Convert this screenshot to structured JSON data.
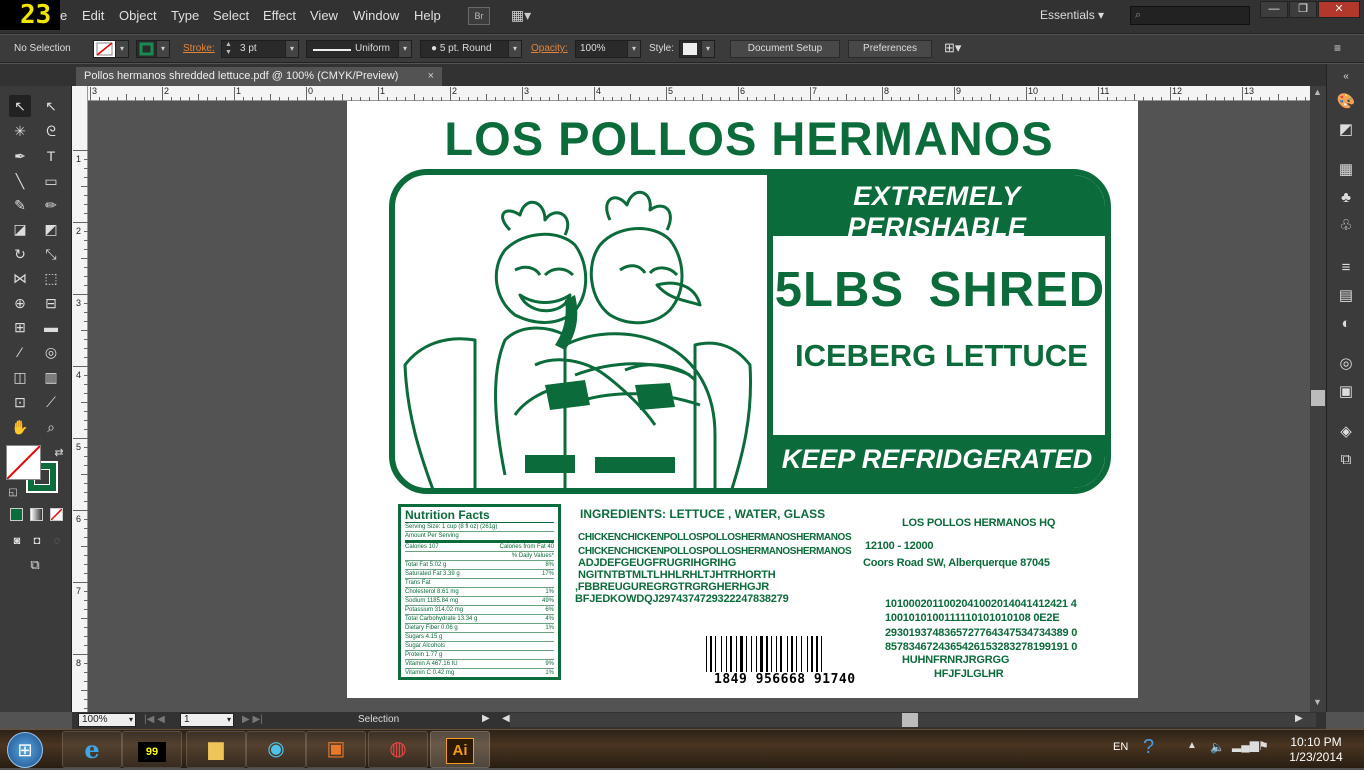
{
  "fps_counter": "23",
  "menu": {
    "app_partial": "e",
    "items": [
      "Edit",
      "Object",
      "Type",
      "Select",
      "Effect",
      "View",
      "Window",
      "Help"
    ],
    "bridge_label": "Br",
    "workspace": "Essentials",
    "search_placeholder": ""
  },
  "window_controls": {
    "minimize": "—",
    "restore": "❐",
    "close": "✕"
  },
  "control_bar": {
    "selection": "No Selection",
    "stroke_label": "Stroke:",
    "stroke_value": "3 pt",
    "profile": "Uniform",
    "brush": "5 pt. Round",
    "opacity_label": "Opacity:",
    "opacity_value": "100%",
    "style_label": "Style:",
    "document_setup": "Document Setup",
    "preferences": "Preferences"
  },
  "document_tab": {
    "title": "Pollos hermanos shredded lettuce.pdf @ 100% (CMYK/Preview)",
    "close": "×"
  },
  "ruler": {
    "h_numbers": [
      "3",
      "2",
      "1",
      "0",
      "1",
      "2",
      "3",
      "4",
      "5",
      "6",
      "7",
      "8",
      "9",
      "10",
      "11",
      "12",
      "13"
    ],
    "v_numbers": [
      "1",
      "2",
      "3",
      "4",
      "5",
      "6",
      "7",
      "8"
    ]
  },
  "label": {
    "title": "LOS POLLOS HERMANOS",
    "extremely_perishable": "EXTREMELY PERISHABLE",
    "weight": "5LBS  SHRED",
    "product": "ICEBERG LETTUCE",
    "keep_refrigerated": "KEEP REFRIDGERATED",
    "nutrition": {
      "title": "Nutrition Facts",
      "serving": "Serving Size: 1 cup (8 fl oz) (261g)",
      "amount": "Amount Per Serving",
      "calories": [
        "Calories  107",
        "Calories from Fat  40"
      ],
      "dv_header": "% Daily Values*",
      "rows": [
        [
          "Total Fat  5.02 g",
          "8%"
        ],
        [
          "  Saturated Fat  3.39 g",
          "17%"
        ],
        [
          "  Trans Fat",
          ""
        ],
        [
          "Cholesterol  8.61 mg",
          "1%"
        ],
        [
          "Sodium  1185.84 mg",
          "49%"
        ],
        [
          "Potassium  314.02 mg",
          "6%"
        ],
        [
          "Total Carbohydrate  13.34 g",
          "4%"
        ],
        [
          "  Dietary Fiber  0.06 g",
          "1%"
        ],
        [
          "  Sugars  4.15 g",
          ""
        ],
        [
          "  Sugar Alcohols",
          ""
        ],
        [
          "Protein  1.77 g",
          ""
        ],
        [
          "Vitamin A  467.16 IU",
          "9%"
        ],
        [
          "Vitamin C  0.42 mg",
          "1%"
        ],
        [
          "Calcium  75.69 mg",
          "8%"
        ]
      ]
    },
    "ingredients": "INGREDIENTS: LETTUCE , WATER, GLASS",
    "code_lines": [
      "CHICKENCHICKENPOLLOSPOLLOSHERMANOSHERMANOS",
      "CHICKENCHICKENPOLLOSPOLLOSHERMANOSHERMANOS",
      "ADJDEFGEUGFRUGRIHGRIHG",
      "NGITNTBTMLTLHHLRHLTJHTRHORTH",
      ",FBBREUGUREGRGTRGRGHERHGJR",
      " BFJEDKOWDQJ2974374729322247838279"
    ],
    "hq": {
      "name": "LOS POLLOS HERMANOS HQ",
      "street_number": "12100 - 12000",
      "address": "Coors Road SW, Alberquerque 87045"
    },
    "number_lines": [
      "1010002011002041002014041412421 4",
      "1001010100111110101010108 0E2E",
      "2930193748365727764347534734389 0",
      "8578346724365426153283278199191 0",
      "HUHNFRNRJRGRGG",
      "HFJFJLGLHR"
    ],
    "barcode_number": "1849 956668 91740"
  },
  "status_bar": {
    "zoom": "100%",
    "artboard_num": "1",
    "tool": "Selection"
  },
  "taskbar": {
    "language": "EN",
    "time": "10:10 PM",
    "date": "1/23/2014",
    "ai_label": "Ai",
    "badge": "99"
  },
  "colors": {
    "brand_green": "#0b6b3a",
    "ui_dark": "#323232",
    "stroke_orange": "#e2853a"
  }
}
